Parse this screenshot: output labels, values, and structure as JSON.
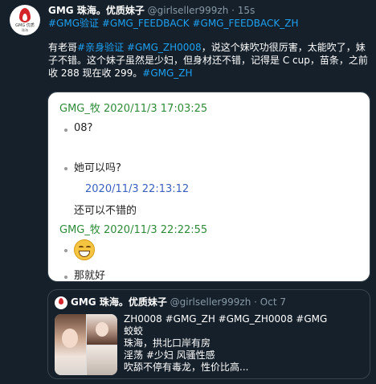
{
  "tweet": {
    "avatar_caption": "GMG 优质",
    "avatar_sub": "珠海",
    "name": "GMG 珠海。优质妹子",
    "handle": "@girlseller999zh",
    "separator": "·",
    "time": "15s",
    "hashtags": [
      "#GMG验证",
      "#GMG_FEEDBACK",
      "#GMG_FEEDBACK_ZH"
    ],
    "body": {
      "prefix": "有老哥",
      "tag1": "#亲身验证",
      "tag2": "#GMG_ZH0008",
      "text1": "，说这个妹吹功很厉害，太能吹了，妹子不错。这个妹子虽然是少妇，但身材还不错，记得是 C cup，苗条，之前收 288 现在收 299。",
      "tag3": "#GMG_ZH"
    }
  },
  "media": {
    "line1": "GMG_牧 2020/11/3 17:03:25",
    "line2": "08?",
    "line3": "她可以吗?",
    "line4": "2020/11/3 22:13:12",
    "line5": "还可以不错的",
    "line6": "GMG_牧 2020/11/3 22:22:55",
    "line7": "那就好"
  },
  "quote": {
    "name": "GMG 珠海。优质妹子",
    "handle": "@girlseller999zh",
    "separator": "·",
    "time": "Oct 7",
    "lines": [
      "ZH0008 #GMG_ZH #GMG_ZH0008 #GMG",
      "蛟蛟",
      "珠海，拱北口岸有房",
      "淫荡 #少妇 风骚性感",
      "吹舔不停有毒龙，性价比高..."
    ]
  },
  "colors": {
    "background": "#15202b",
    "link": "#1da1f2",
    "muted": "#8899a6",
    "chat_green": "#2e8b3a",
    "chat_blue": "#3b5fc0"
  }
}
